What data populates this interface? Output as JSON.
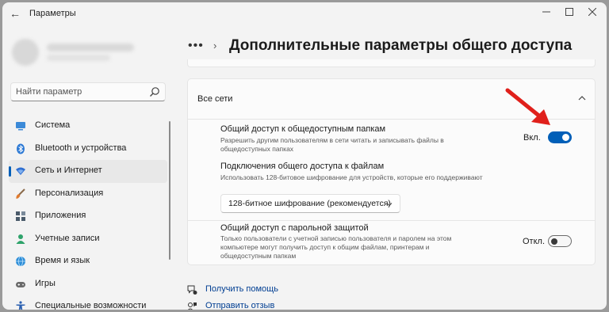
{
  "window": {
    "title": "Параметры",
    "back_icon": "arrow-left-icon"
  },
  "search": {
    "placeholder": "Найти параметр",
    "icon": "search-icon"
  },
  "nav": {
    "items": [
      {
        "label": "Система",
        "icon": "monitor-icon",
        "color": "#3c8ad8",
        "active": false
      },
      {
        "label": "Bluetooth и устройства",
        "icon": "bluetooth-icon",
        "color": "#2b78d4",
        "active": false
      },
      {
        "label": "Сеть и Интернет",
        "icon": "wifi-icon",
        "color": "#2f6fd1",
        "active": true
      },
      {
        "label": "Персонализация",
        "icon": "brush-icon",
        "color": "#e07a2e",
        "active": false
      },
      {
        "label": "Приложения",
        "icon": "apps-icon",
        "color": "#4a5a6a",
        "active": false
      },
      {
        "label": "Учетные записи",
        "icon": "person-icon",
        "color": "#2fa36b",
        "active": false
      },
      {
        "label": "Время и язык",
        "icon": "globe-icon",
        "color": "#2f8fd8",
        "active": false
      },
      {
        "label": "Игры",
        "icon": "gamepad-icon",
        "color": "#6a6a6a",
        "active": false
      },
      {
        "label": "Специальные возможности",
        "icon": "accessibility-icon",
        "color": "#2a5fb0",
        "active": false
      }
    ]
  },
  "breadcrumb": {
    "more": "•••",
    "separator": "›",
    "title": "Дополнительные параметры общего доступа"
  },
  "section": {
    "title": "Все сети",
    "settings": [
      {
        "title": "Общий доступ к общедоступным папкам",
        "description": "Разрешить другим пользователям в сети читать и записывать файлы в общедоступных папках",
        "state_label": "Вкл.",
        "on": true
      },
      {
        "title": "Подключения общего доступа к файлам",
        "description": "Использовать 128-битовое шифрование для устройств, которые его поддерживают",
        "select_value": "128-битное шифрование (рекомендуется)"
      },
      {
        "title": "Общий доступ с парольной защитой",
        "description": "Только пользователи с учетной записью пользователя и паролем на этом компьютере могут получить доступ к общим файлам, принтерам и общедоступным папкам",
        "state_label": "Откл.",
        "on": false
      }
    ]
  },
  "links": [
    {
      "label": "Получить помощь",
      "icon": "help-icon"
    },
    {
      "label": "Отправить отзыв",
      "icon": "feedback-icon"
    }
  ],
  "colors": {
    "accent": "#005fb8",
    "arrow": "#e0201b"
  }
}
